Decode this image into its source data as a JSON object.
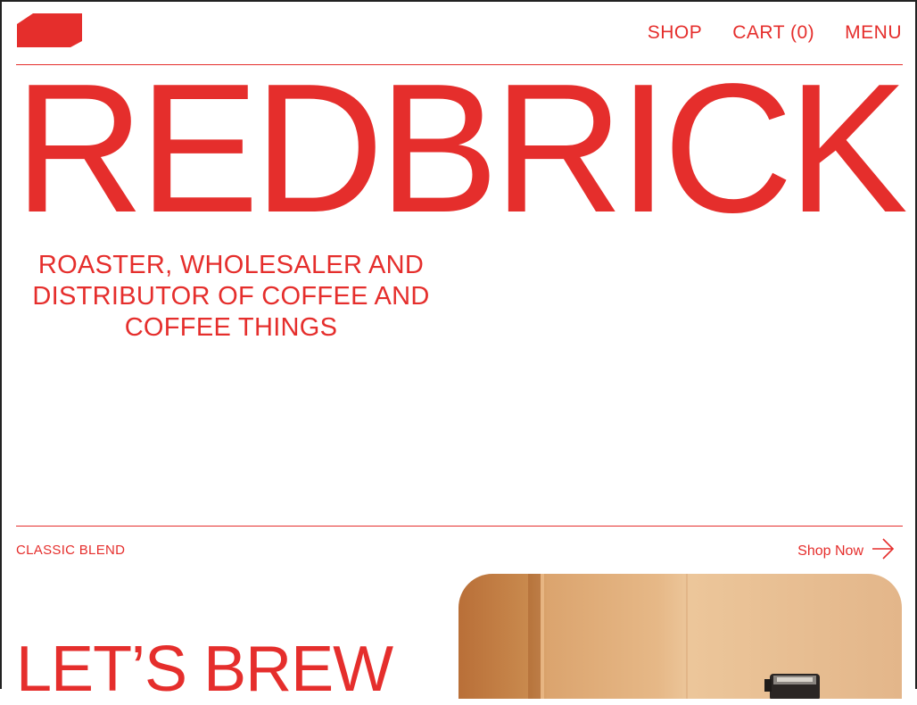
{
  "nav": {
    "shop_label": "SHOP",
    "cart_label": "CART (0)",
    "menu_label": "MENU"
  },
  "hero": {
    "wordmark": "REDBRICK",
    "tagline": "ROASTER, WHOLESALER AND DISTRIBUTOR OF COFFEE AND COFFEE THINGS"
  },
  "featured": {
    "label": "CLASSIC BLEND",
    "cta_label": "Shop Now",
    "cta_icon": "arrow-right-icon",
    "heading": "LET’S BREW"
  },
  "icons": {
    "logo": "brick-logo-icon"
  },
  "colors": {
    "accent": "#e52e2c",
    "background": "#ffffff"
  }
}
